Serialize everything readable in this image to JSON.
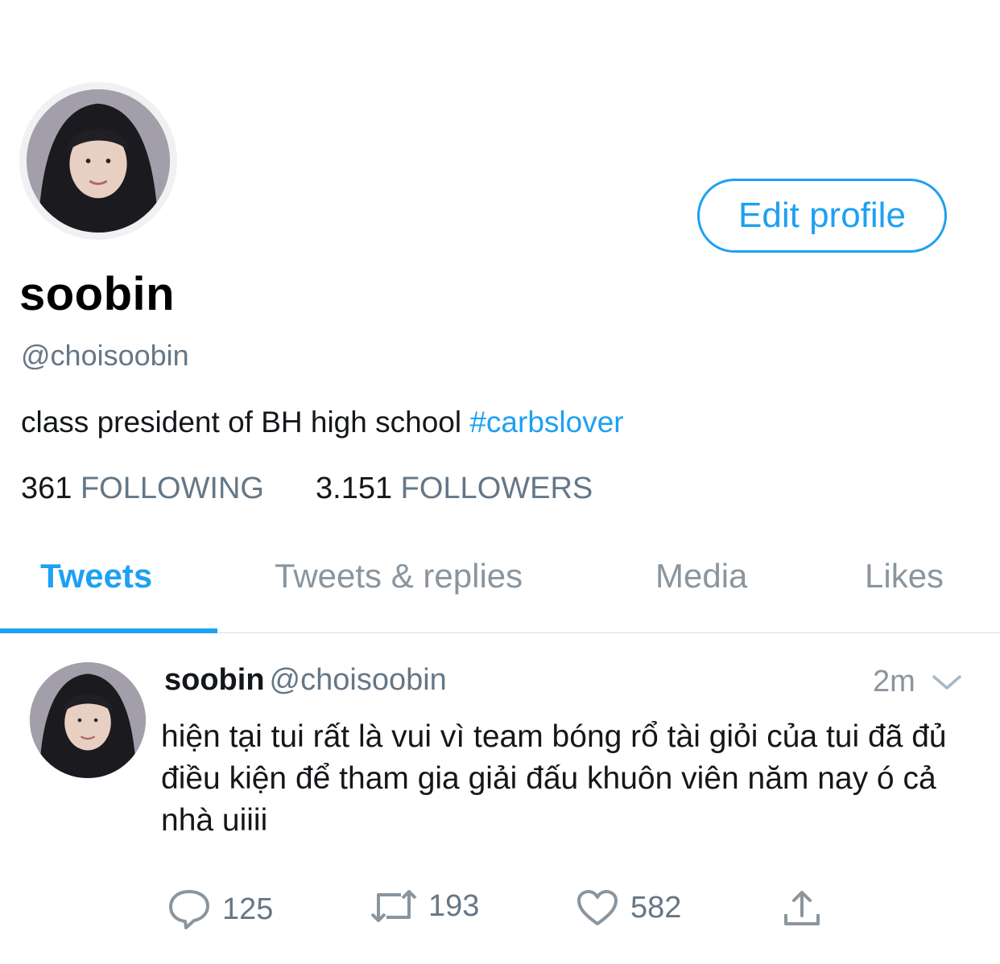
{
  "profile": {
    "display_name": "soobin",
    "handle": "@choisoobin",
    "bio_text": "class president of BH high school ",
    "bio_hashtag": "#carbslover",
    "edit_button": "Edit profile",
    "following_count": "361",
    "following_label": "FOLLOWING",
    "followers_count": "3.151",
    "followers_label": "FOLLOWERS"
  },
  "tabs": [
    {
      "label": "Tweets",
      "active": true
    },
    {
      "label": "Tweets & replies",
      "active": false
    },
    {
      "label": "Media",
      "active": false
    },
    {
      "label": "Likes",
      "active": false
    }
  ],
  "tweet": {
    "name": "soobin",
    "handle": "@choisoobin",
    "time": "2m",
    "text": "hiện tại tui rất là vui vì team bóng rổ tài giỏi của tui đã đủ điều kiện để tham gia giải đấu khuôn viên năm nay ó cả nhà uiiii",
    "reply_count": "125",
    "retweet_count": "193",
    "like_count": "582"
  },
  "icons": {
    "reply": "reply-icon",
    "retweet": "retweet-icon",
    "like": "heart-icon",
    "share": "share-icon",
    "menu": "chevron-down-icon"
  },
  "colors": {
    "accent": "#1da1f2",
    "secondary_text": "#657786"
  }
}
